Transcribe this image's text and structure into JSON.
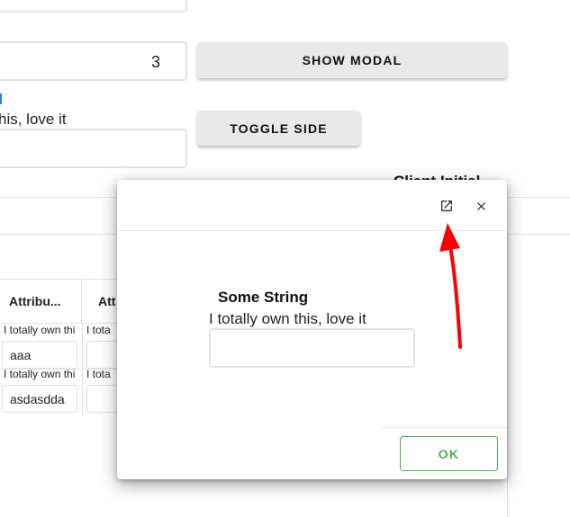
{
  "background": {
    "top_field_value": "",
    "number_field_value": "3",
    "show_modal_label": "SHOW MODAL",
    "toggle_side_label": "TOGGLE SIDE",
    "partial_text": "his, love it",
    "partial_title": "Client Initial",
    "table": {
      "headers": [
        "Attribu...",
        "Att"
      ],
      "rows": [
        {
          "helper": "I totally own thi",
          "helper2": "I tota",
          "value": "aaa"
        },
        {
          "helper": "I totally own thi",
          "helper2": "I tota",
          "value": "asdasdda"
        }
      ]
    }
  },
  "modal": {
    "label": "Some String",
    "description": "I totally own this, love it",
    "input_value": "",
    "ok_label": "OK",
    "icons": {
      "open": "open-in-new-icon",
      "close": "close-icon"
    }
  },
  "colors": {
    "ok_green": "#4caf50",
    "annotation_red": "#ff0000",
    "accent_blue": "#1976d2"
  }
}
